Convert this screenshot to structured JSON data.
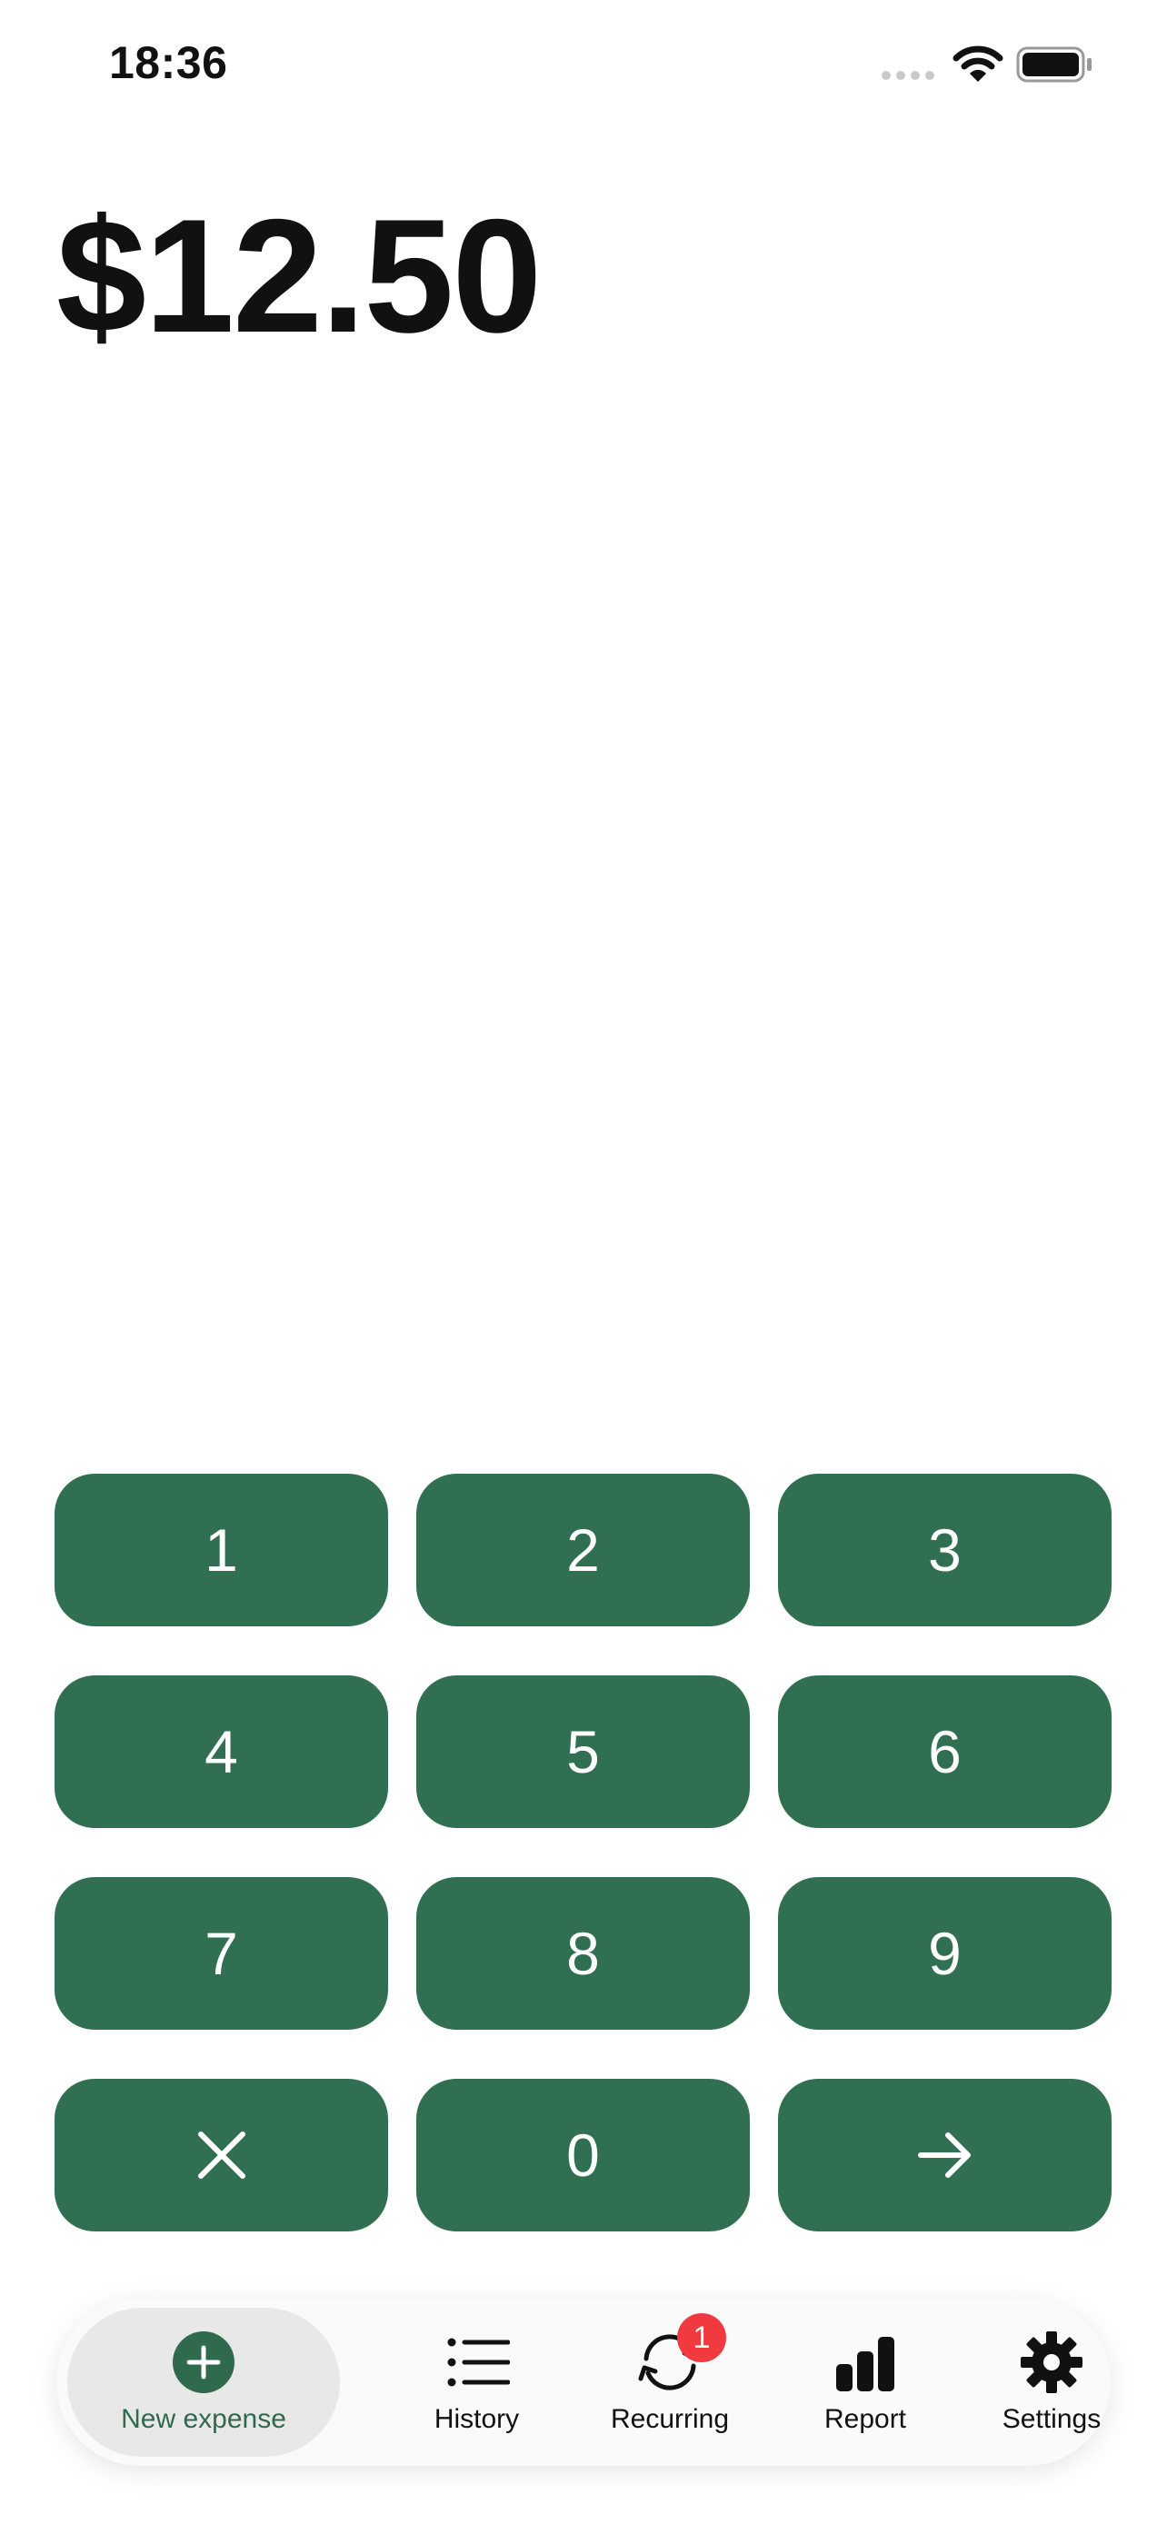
{
  "status_bar": {
    "time": "18:36"
  },
  "amount": "$12.50",
  "keypad": {
    "keys": [
      "1",
      "2",
      "3",
      "4",
      "5",
      "6",
      "7",
      "8",
      "9",
      "0"
    ],
    "clear_icon": "close-icon",
    "next_icon": "arrow-right-icon"
  },
  "tabbar": {
    "tabs": [
      {
        "label": "New expense",
        "icon": "plus-circle-icon",
        "active": true
      },
      {
        "label": "History",
        "icon": "list-icon"
      },
      {
        "label": "Recurring",
        "icon": "repeat-icon",
        "badge": "1"
      },
      {
        "label": "Report",
        "icon": "bar-chart-icon"
      },
      {
        "label": "Settings",
        "icon": "gear-icon"
      }
    ]
  },
  "colors": {
    "accent": "#316f52",
    "badge": "#f03a3f",
    "active_tab_bg": "#e8e8e8"
  }
}
